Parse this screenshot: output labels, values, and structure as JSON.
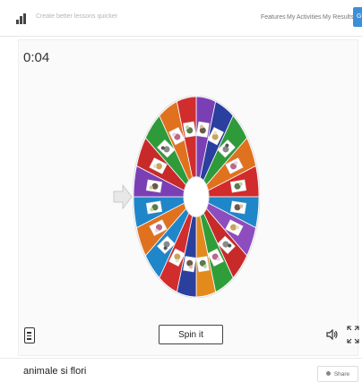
{
  "header": {
    "tagline": "Create better lessons quicker",
    "nav": [
      "Features",
      "My Activities",
      "My Results"
    ],
    "corner_button": "Gi"
  },
  "player": {
    "timer": "0:04",
    "spin_label": "Spin it"
  },
  "wheel": {
    "segment_count": 20,
    "colors": [
      "#7b3fb5",
      "#2a3f9e",
      "#2f9a3a",
      "#e0721f",
      "#d22b2b",
      "#1f86c9",
      "#8d4dbf",
      "#c82a2a",
      "#2f9e3a",
      "#e48a1d",
      "#2a3f9e",
      "#d12d2d",
      "#1f86c9",
      "#e0721f",
      "#1f86c9",
      "#7b3fb5",
      "#c82a2a",
      "#2f9a3a",
      "#e0721f",
      "#d12d2d"
    ]
  },
  "activity": {
    "title": "animale si flori",
    "share_label": "Share"
  }
}
